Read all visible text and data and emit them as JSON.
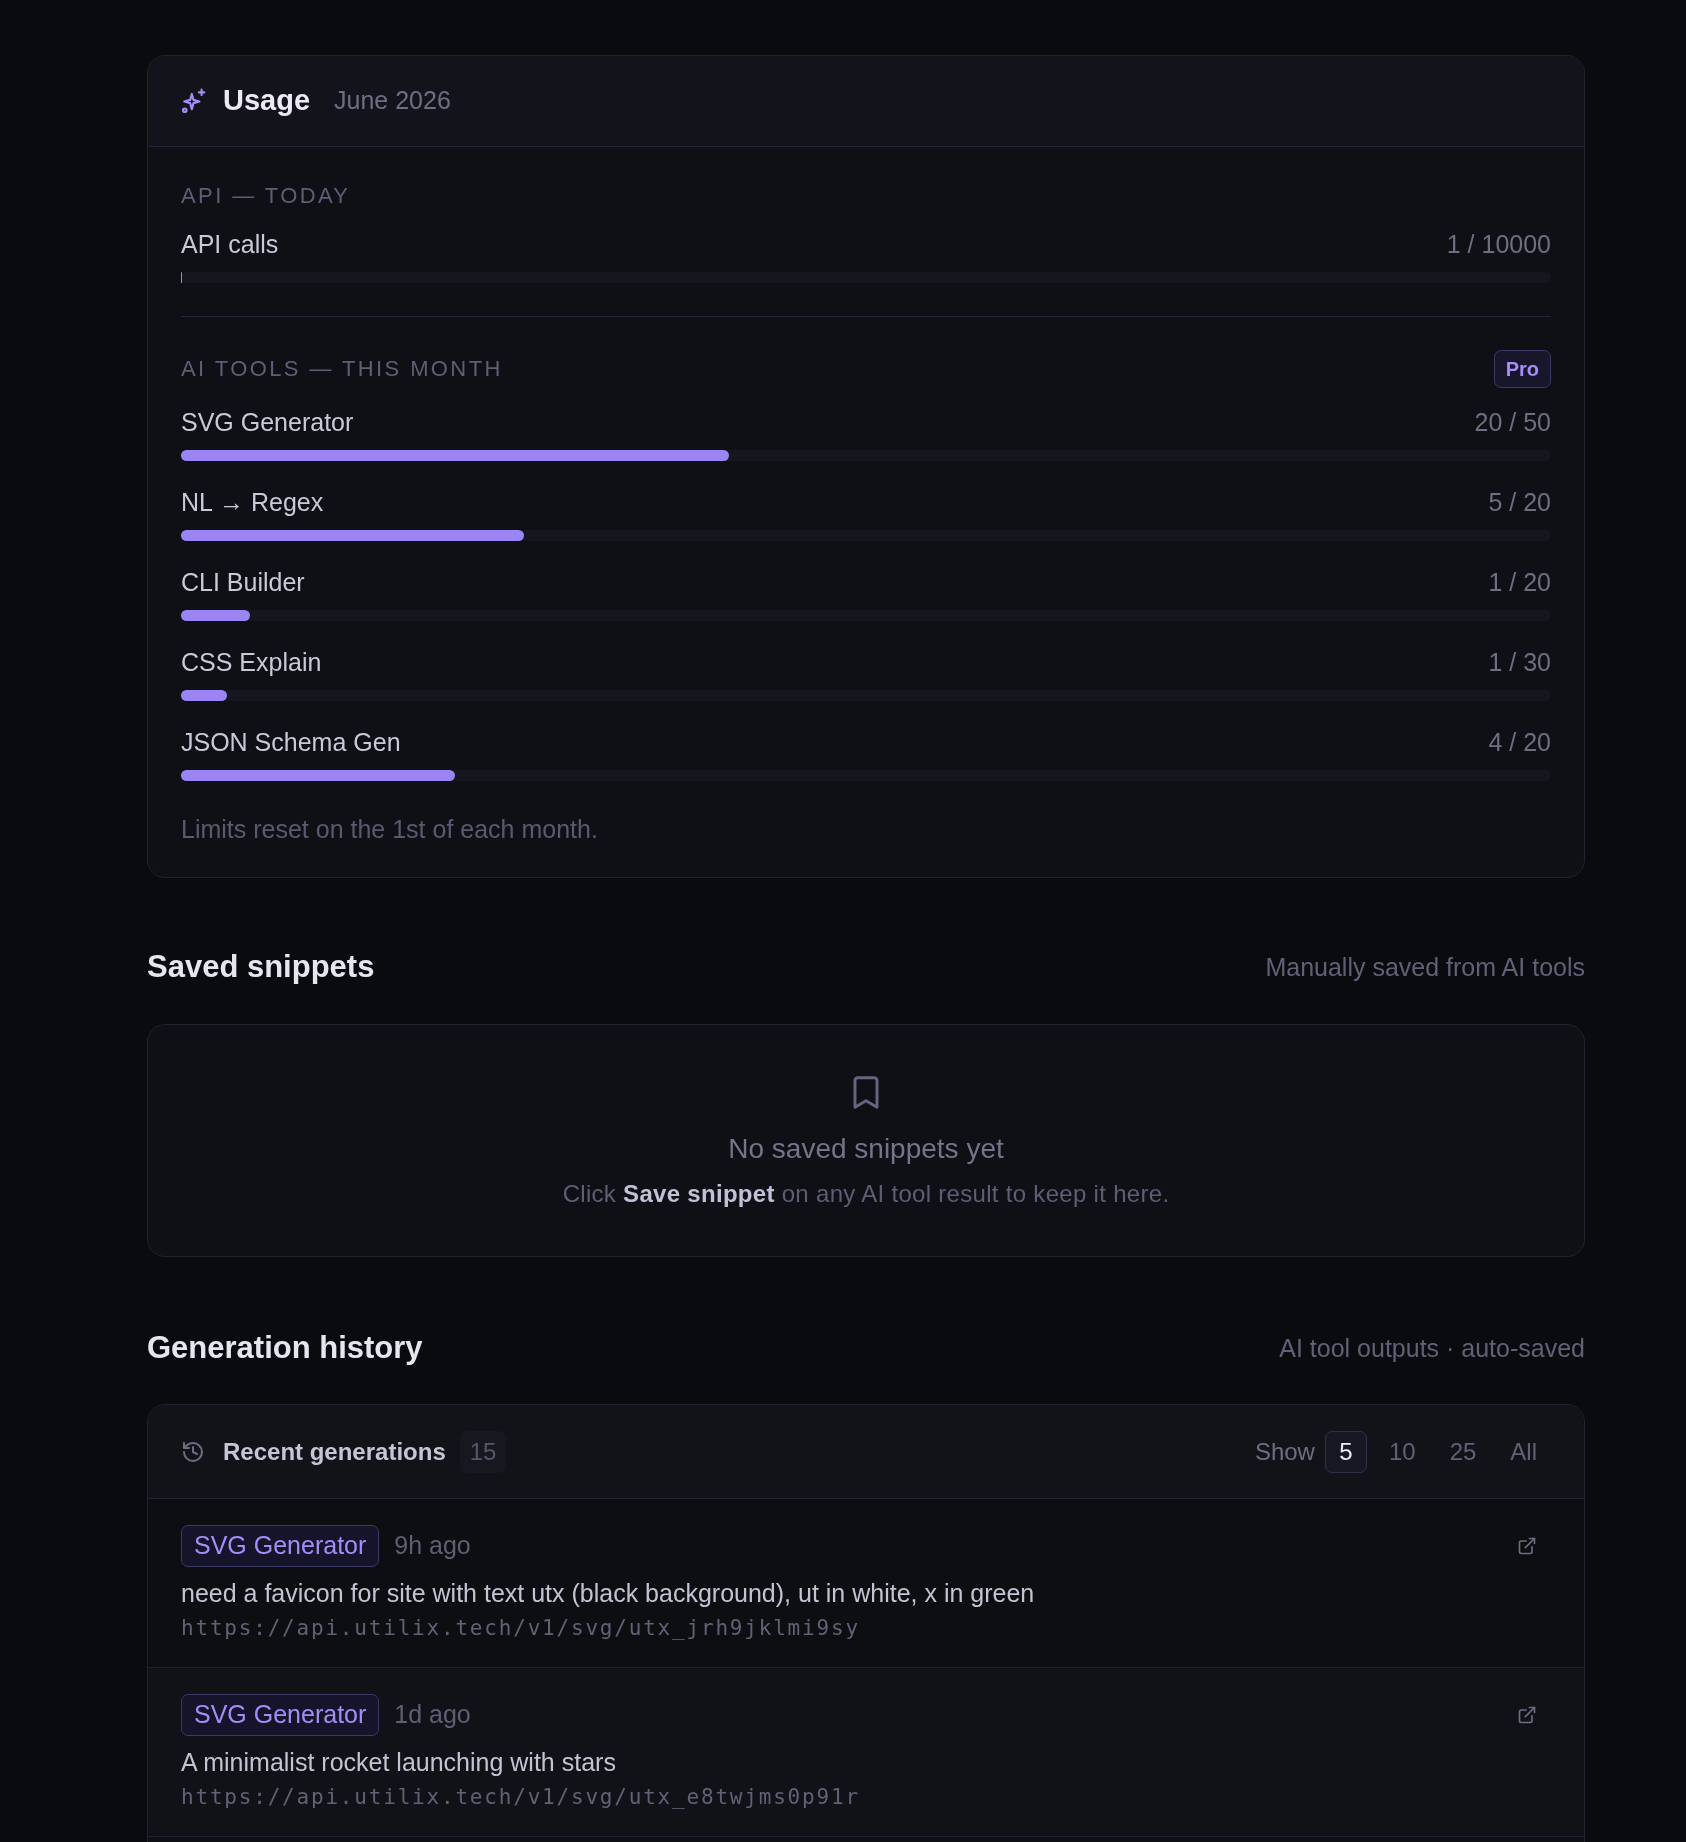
{
  "usage": {
    "title": "Usage",
    "period": "June 2026",
    "api_section": {
      "heading": "API — TODAY",
      "meters": [
        {
          "label": "API calls",
          "reading": "1 / 10000",
          "level": 0.0001
        }
      ]
    },
    "ai_tools_section": {
      "heading": "AI TOOLS — THIS MONTH",
      "badge": "Pro",
      "meters": [
        {
          "label": "SVG Generator",
          "reading": "20 / 50",
          "level": 0.4
        },
        {
          "label": "NL → Regex",
          "reading": "5 / 20",
          "level": 0.25
        },
        {
          "label": "CLI Builder",
          "reading": "1 / 20",
          "level": 0.05
        },
        {
          "label": "CSS Explain",
          "reading": "1 / 30",
          "level": 0.0333
        },
        {
          "label": "JSON Schema Gen",
          "reading": "4 / 20",
          "level": 0.2
        }
      ]
    },
    "note": "Limits reset on the 1st of each month."
  },
  "saved_snippets": {
    "title": "Saved snippets",
    "subtitle": "Manually saved from AI tools",
    "empty_state": {
      "title": "No saved snippets yet",
      "hint": "Click **Save snippet** on any AI tool result to keep it here."
    }
  },
  "generation_history": {
    "title": "Generation history",
    "subtitle": "AI tool outputs · auto-saved",
    "panel": {
      "title": "Recent generations",
      "count": "15",
      "show_label": "Show",
      "page_sizes": [
        {
          "label": "5",
          "selected": true
        },
        {
          "label": "10",
          "selected": false
        },
        {
          "label": "25",
          "selected": false
        },
        {
          "label": "All",
          "selected": false
        }
      ],
      "items": [
        {
          "tool": "SVG Generator",
          "time": "9h ago",
          "prompt": "need a favicon for site with text utx (black background), ut in white, x in green",
          "url": "https://api.utilix.tech/v1/svg/utx_jrh9jklmi9sy"
        },
        {
          "tool": "SVG Generator",
          "time": "1d ago",
          "prompt": "A minimalist rocket launching with stars",
          "url": "https://api.utilix.tech/v1/svg/utx_e8twjms0p91r"
        }
      ]
    }
  }
}
